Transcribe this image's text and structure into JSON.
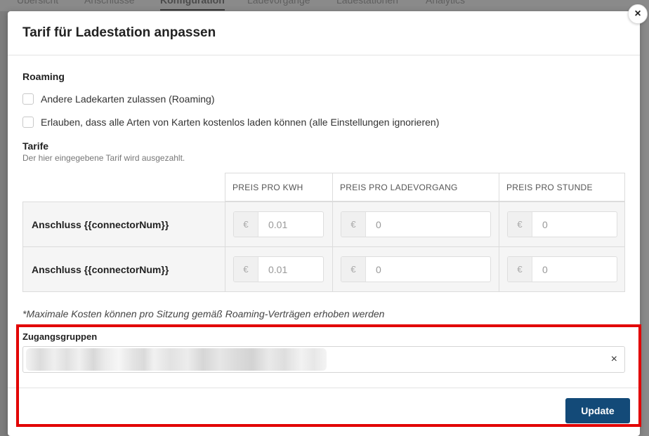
{
  "background_tabs": [
    "Übersicht",
    "Anschlüsse",
    "Konfiguration",
    "Ladevorgänge",
    "Ladestationen",
    "Analytics"
  ],
  "modal": {
    "title": "Tarif für Ladestation anpassen",
    "close_icon": "×"
  },
  "roaming": {
    "heading": "Roaming",
    "options": [
      {
        "label": "Andere Ladekarten zulassen (Roaming)",
        "checked": false
      },
      {
        "label": "Erlauben, dass alle Arten von Karten kostenlos laden können (alle Einstellungen ignorieren)",
        "checked": false
      }
    ]
  },
  "tariffs": {
    "heading": "Tarife",
    "hint": "Der hier eingegebene Tarif wird ausgezahlt.",
    "columns": [
      "PREIS PRO KWH",
      "PREIS PRO LADEVORGANG",
      "PREIS PRO STUNDE"
    ],
    "currency_symbol": "€",
    "rows": [
      {
        "label": "Anschluss {{connectorNum}}",
        "values": [
          "0.01",
          "0",
          "0"
        ]
      },
      {
        "label": "Anschluss {{connectorNum}}",
        "values": [
          "0.01",
          "0",
          "0"
        ]
      }
    ],
    "note": "*Maximale Kosten können pro Sitzung gemäß Roaming-Verträgen erhoben werden"
  },
  "access_groups": {
    "label": "Zugangsgruppen",
    "clear_icon": "×"
  },
  "actions": {
    "update_label": "Update"
  },
  "colors": {
    "primary_button": "#134a78",
    "highlight_border": "#e20000"
  }
}
